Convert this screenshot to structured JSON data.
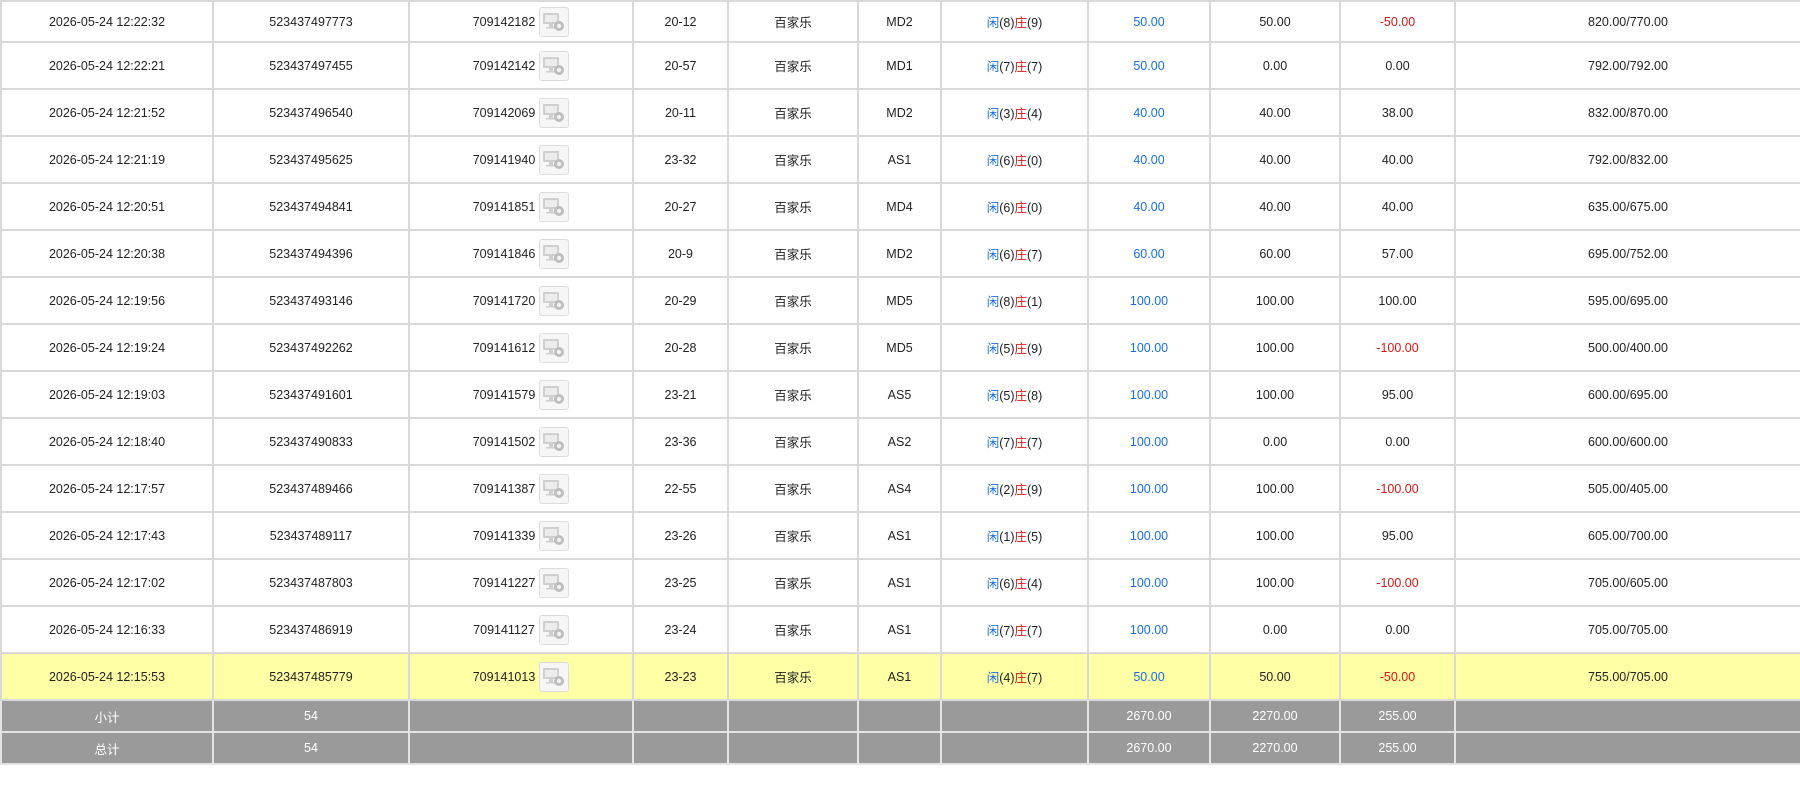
{
  "rows": [
    {
      "time": "2026-05-24 12:22:32",
      "order_no": "523437497773",
      "game_no": "709142182",
      "round": "20-12",
      "game": "百家乐",
      "table": "MD2",
      "player_label": "闲",
      "player_pts": "(8)",
      "banker_label": "庄",
      "banker_pts": "(9)",
      "bet": "50.00",
      "valid": "50.00",
      "win": "-50.00",
      "win_color": "red",
      "balance": "820.00/770.00"
    },
    {
      "time": "2026-05-24 12:22:21",
      "order_no": "523437497455",
      "game_no": "709142142",
      "round": "20-57",
      "game": "百家乐",
      "table": "MD1",
      "player_label": "闲",
      "player_pts": "(7)",
      "banker_label": "庄",
      "banker_pts": "(7)",
      "bet": "50.00",
      "valid": "0.00",
      "win": "0.00",
      "win_color": "black",
      "balance": "792.00/792.00"
    },
    {
      "time": "2026-05-24 12:21:52",
      "order_no": "523437496540",
      "game_no": "709142069",
      "round": "20-11",
      "game": "百家乐",
      "table": "MD2",
      "player_label": "闲",
      "player_pts": "(3)",
      "banker_label": "庄",
      "banker_pts": "(4)",
      "bet": "40.00",
      "valid": "40.00",
      "win": "38.00",
      "win_color": "black",
      "balance": "832.00/870.00"
    },
    {
      "time": "2026-05-24 12:21:19",
      "order_no": "523437495625",
      "game_no": "709141940",
      "round": "23-32",
      "game": "百家乐",
      "table": "AS1",
      "player_label": "闲",
      "player_pts": "(6)",
      "banker_label": "庄",
      "banker_pts": "(0)",
      "bet": "40.00",
      "valid": "40.00",
      "win": "40.00",
      "win_color": "black",
      "balance": "792.00/832.00"
    },
    {
      "time": "2026-05-24 12:20:51",
      "order_no": "523437494841",
      "game_no": "709141851",
      "round": "20-27",
      "game": "百家乐",
      "table": "MD4",
      "player_label": "闲",
      "player_pts": "(6)",
      "banker_label": "庄",
      "banker_pts": "(0)",
      "bet": "40.00",
      "valid": "40.00",
      "win": "40.00",
      "win_color": "black",
      "balance": "635.00/675.00"
    },
    {
      "time": "2026-05-24 12:20:38",
      "order_no": "523437494396",
      "game_no": "709141846",
      "round": "20-9",
      "game": "百家乐",
      "table": "MD2",
      "player_label": "闲",
      "player_pts": "(6)",
      "banker_label": "庄",
      "banker_pts": "(7)",
      "bet": "60.00",
      "valid": "60.00",
      "win": "57.00",
      "win_color": "black",
      "balance": "695.00/752.00"
    },
    {
      "time": "2026-05-24 12:19:56",
      "order_no": "523437493146",
      "game_no": "709141720",
      "round": "20-29",
      "game": "百家乐",
      "table": "MD5",
      "player_label": "闲",
      "player_pts": "(8)",
      "banker_label": "庄",
      "banker_pts": "(1)",
      "bet": "100.00",
      "valid": "100.00",
      "win": "100.00",
      "win_color": "black",
      "balance": "595.00/695.00"
    },
    {
      "time": "2026-05-24 12:19:24",
      "order_no": "523437492262",
      "game_no": "709141612",
      "round": "20-28",
      "game": "百家乐",
      "table": "MD5",
      "player_label": "闲",
      "player_pts": "(5)",
      "banker_label": "庄",
      "banker_pts": "(9)",
      "bet": "100.00",
      "valid": "100.00",
      "win": "-100.00",
      "win_color": "red",
      "balance": "500.00/400.00"
    },
    {
      "time": "2026-05-24 12:19:03",
      "order_no": "523437491601",
      "game_no": "709141579",
      "round": "23-21",
      "game": "百家乐",
      "table": "AS5",
      "player_label": "闲",
      "player_pts": "(5)",
      "banker_label": "庄",
      "banker_pts": "(8)",
      "bet": "100.00",
      "valid": "100.00",
      "win": "95.00",
      "win_color": "black",
      "balance": "600.00/695.00"
    },
    {
      "time": "2026-05-24 12:18:40",
      "order_no": "523437490833",
      "game_no": "709141502",
      "round": "23-36",
      "game": "百家乐",
      "table": "AS2",
      "player_label": "闲",
      "player_pts": "(7)",
      "banker_label": "庄",
      "banker_pts": "(7)",
      "bet": "100.00",
      "valid": "0.00",
      "win": "0.00",
      "win_color": "black",
      "balance": "600.00/600.00"
    },
    {
      "time": "2026-05-24 12:17:57",
      "order_no": "523437489466",
      "game_no": "709141387",
      "round": "22-55",
      "game": "百家乐",
      "table": "AS4",
      "player_label": "闲",
      "player_pts": "(2)",
      "banker_label": "庄",
      "banker_pts": "(9)",
      "bet": "100.00",
      "valid": "100.00",
      "win": "-100.00",
      "win_color": "red",
      "balance": "505.00/405.00"
    },
    {
      "time": "2026-05-24 12:17:43",
      "order_no": "523437489117",
      "game_no": "709141339",
      "round": "23-26",
      "game": "百家乐",
      "table": "AS1",
      "player_label": "闲",
      "player_pts": "(1)",
      "banker_label": "庄",
      "banker_pts": "(5)",
      "bet": "100.00",
      "valid": "100.00",
      "win": "95.00",
      "win_color": "black",
      "balance": "605.00/700.00"
    },
    {
      "time": "2026-05-24 12:17:02",
      "order_no": "523437487803",
      "game_no": "709141227",
      "round": "23-25",
      "game": "百家乐",
      "table": "AS1",
      "player_label": "闲",
      "player_pts": "(6)",
      "banker_label": "庄",
      "banker_pts": "(4)",
      "bet": "100.00",
      "valid": "100.00",
      "win": "-100.00",
      "win_color": "red",
      "balance": "705.00/605.00"
    },
    {
      "time": "2026-05-24 12:16:33",
      "order_no": "523437486919",
      "game_no": "709141127",
      "round": "23-24",
      "game": "百家乐",
      "table": "AS1",
      "player_label": "闲",
      "player_pts": "(7)",
      "banker_label": "庄",
      "banker_pts": "(7)",
      "bet": "100.00",
      "valid": "0.00",
      "win": "0.00",
      "win_color": "black",
      "balance": "705.00/705.00"
    },
    {
      "time": "2026-05-24 12:15:53",
      "order_no": "523437485779",
      "game_no": "709141013",
      "round": "23-23",
      "game": "百家乐",
      "table": "AS1",
      "player_label": "闲",
      "player_pts": "(4)",
      "banker_label": "庄",
      "banker_pts": "(7)",
      "bet": "50.00",
      "valid": "50.00",
      "win": "-50.00",
      "win_color": "red",
      "balance": "755.00/705.00",
      "highlight": true
    }
  ],
  "subtotal": {
    "label": "小计",
    "count": "54",
    "bet": "2670.00",
    "valid": "2270.00",
    "win": "255.00"
  },
  "total": {
    "label": "总计",
    "count": "54",
    "bet": "2670.00",
    "valid": "2270.00",
    "win": "255.00"
  },
  "colors": {
    "bet_blue": "#1a6fe0",
    "loss_red": "#e01515",
    "highlight_row": "#ffffa6",
    "summary_row": "#9a9a9a"
  },
  "icons": {
    "game_record": "game-record-icon"
  }
}
